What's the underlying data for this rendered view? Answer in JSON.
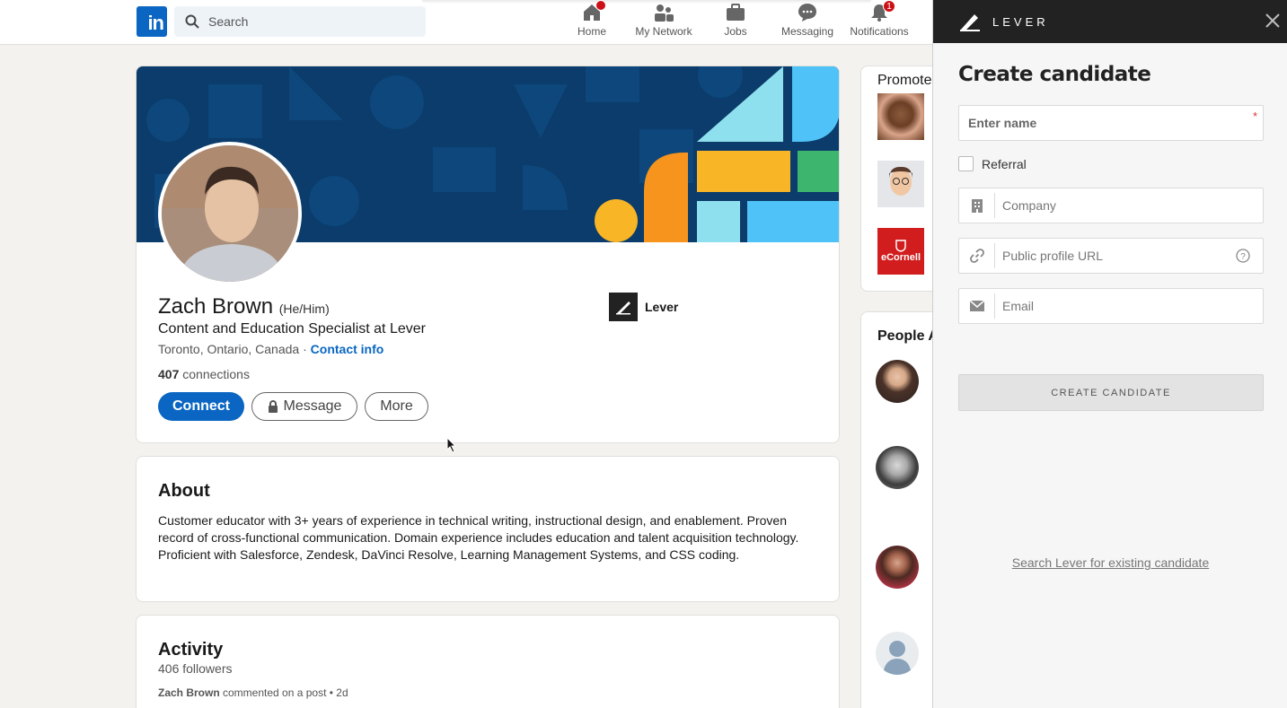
{
  "nav": {
    "search_placeholder": "Search",
    "items": [
      {
        "label": "Home",
        "icon": "home-icon"
      },
      {
        "label": "My Network",
        "icon": "network-icon"
      },
      {
        "label": "Jobs",
        "icon": "briefcase-icon"
      },
      {
        "label": "Messaging",
        "icon": "messaging-icon"
      },
      {
        "label": "Notifications",
        "icon": "bell-icon",
        "badge": "1"
      }
    ]
  },
  "profile": {
    "name": "Zach Brown",
    "pronouns": "(He/Him)",
    "headline": "Content and Education Specialist at Lever",
    "location": "Toronto, Ontario, Canada · ",
    "contact_link": "Contact info",
    "connections_count": "407",
    "connections_label": " connections",
    "company": "Lever",
    "buttons": {
      "connect": "Connect",
      "message": "Message",
      "more": "More"
    }
  },
  "about": {
    "title": "About",
    "text": "Customer educator with 3+ years of experience in technical writing, instructional design, and enablement. Proven record of cross-functional communication. Domain experience includes education and talent acquisition technology. Proficient with Salesforce, Zendesk, DaVinci Resolve, Learning Management Systems, and CSS coding."
  },
  "activity": {
    "title": "Activity",
    "followers": "406 followers",
    "author": "Zach Brown",
    "action": " commented on a post • 2d"
  },
  "right": {
    "promoted_title": "Promote",
    "ecornell_label": "eCornell",
    "people_title": "People A"
  },
  "lever": {
    "brand": "LEVER",
    "title": "Create candidate",
    "name_placeholder": "Enter name",
    "required_mark": "*",
    "referral_label": "Referral",
    "company_placeholder": "Company",
    "url_placeholder": "Public profile URL",
    "email_placeholder": "Email",
    "create_button": "CREATE CANDIDATE",
    "search_link": "Search Lever for existing candidate"
  },
  "colors": {
    "linkedin_blue": "#0a66c2",
    "banner_navy": "#0b3c6b",
    "lever_header": "#222222"
  }
}
